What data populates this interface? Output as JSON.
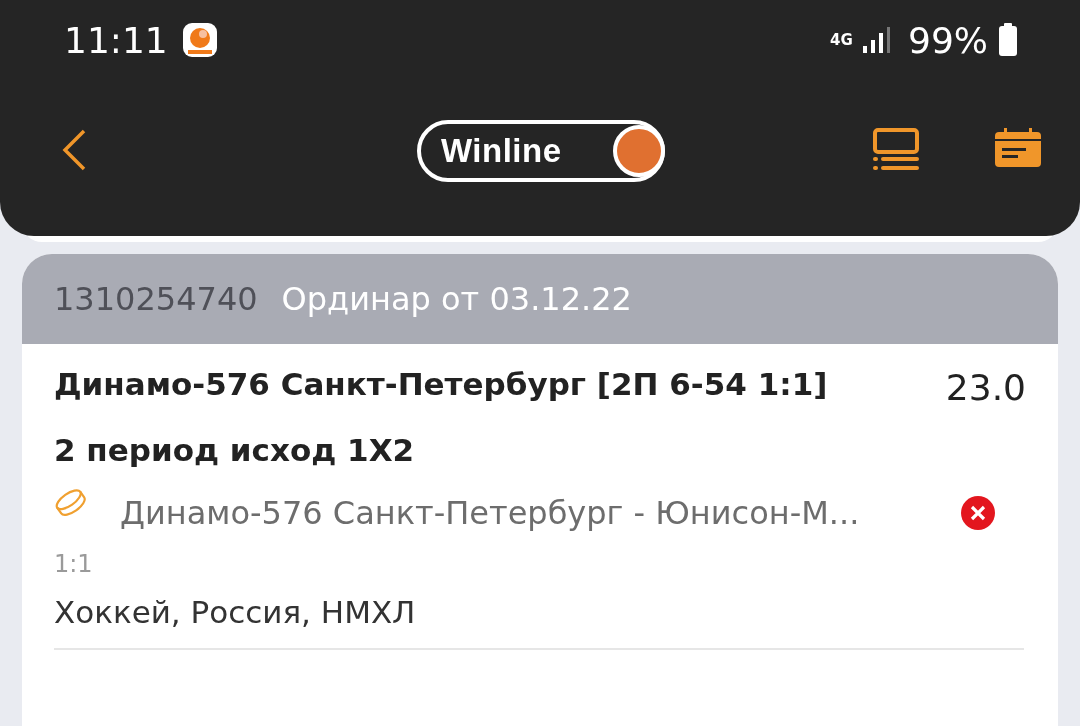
{
  "status_bar": {
    "time": "11:11",
    "network": "4G",
    "battery": "99%"
  },
  "app_bar": {
    "logo": "Winline"
  },
  "bet": {
    "number": "1310254740",
    "title": "Ординар от 03.12.22",
    "selection": "Динамо-576 Санкт-Петербург [2П 6-54 1:1]",
    "odds": "23.0",
    "market": "2 период исход 1X2",
    "event": "Динамо-576 Санкт-Петербург - Юнисон-М...",
    "score": "1:1",
    "league": "Хоккей, Россия, НМХЛ",
    "lost": true
  }
}
